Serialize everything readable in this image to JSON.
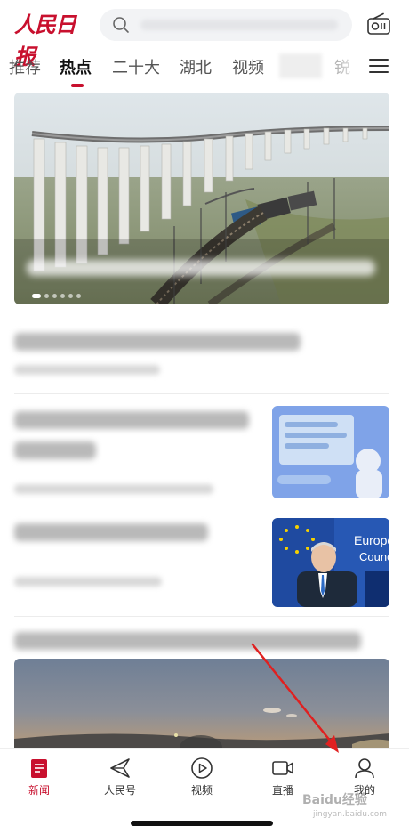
{
  "app": {
    "logo_text": "人民日报",
    "brand_color": "#c8102e"
  },
  "header": {
    "search_icon": "search-icon",
    "radio_icon": "radio-icon"
  },
  "tabs": [
    {
      "label": "推荐",
      "active": false
    },
    {
      "label": "热点",
      "active": true
    },
    {
      "label": "二十大",
      "active": false
    },
    {
      "label": "湖北",
      "active": false
    },
    {
      "label": "视频",
      "active": false
    },
    {
      "label": "锐",
      "active": false
    }
  ],
  "hero": {
    "carousel_count": 6,
    "carousel_active": 0
  },
  "bottom_nav": [
    {
      "label": "新闻",
      "icon": "news-icon",
      "active": true
    },
    {
      "label": "人民号",
      "icon": "paper-plane-icon",
      "active": false
    },
    {
      "label": "视频",
      "icon": "play-icon",
      "active": false
    },
    {
      "label": "直播",
      "icon": "video-camera-icon",
      "active": false
    },
    {
      "label": "我的",
      "icon": "user-icon",
      "active": false
    }
  ],
  "watermark": {
    "text": "Baidu经验",
    "sub": "jingyan.baidu.com"
  },
  "annotation": {
    "arrow_color": "#e02020"
  }
}
